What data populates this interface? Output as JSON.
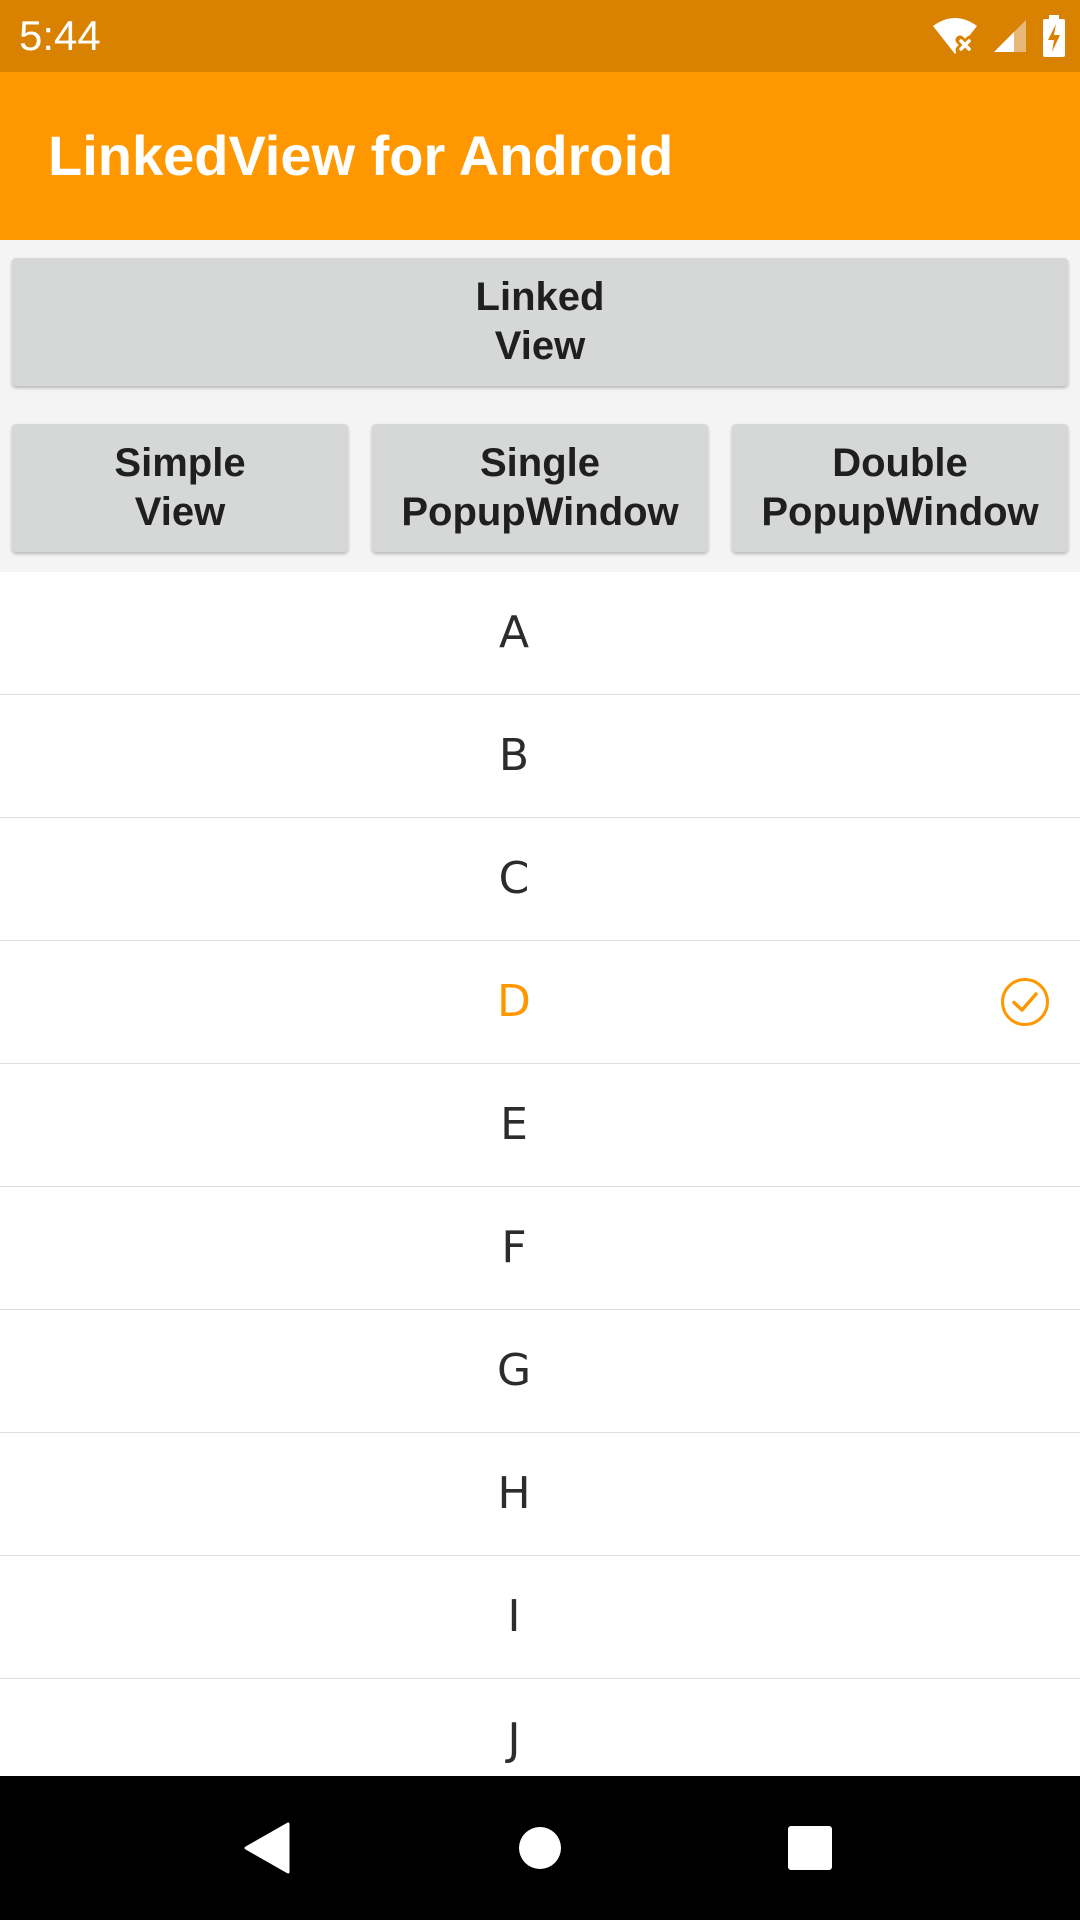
{
  "status_bar": {
    "time": "5:44",
    "icons": [
      "wifi-no-internet-icon",
      "cell-signal-icon",
      "battery-charging-icon"
    ]
  },
  "app_bar": {
    "title": "LinkedView for Android"
  },
  "buttons": {
    "linked_view": "Linked\nView",
    "simple_view": "Simple\nView",
    "single_popup": "Single\nPopupWindow",
    "double_popup": "Double\nPopupWindow"
  },
  "list": {
    "items": [
      {
        "label": "A",
        "selected": false
      },
      {
        "label": "B",
        "selected": false
      },
      {
        "label": "C",
        "selected": false
      },
      {
        "label": "D",
        "selected": true
      },
      {
        "label": "E",
        "selected": false
      },
      {
        "label": "F",
        "selected": false
      },
      {
        "label": "G",
        "selected": false
      },
      {
        "label": "H",
        "selected": false
      },
      {
        "label": "I",
        "selected": false
      },
      {
        "label": "J",
        "selected": false
      }
    ]
  },
  "nav_bar": {
    "icons": [
      "back-icon",
      "home-icon",
      "recents-icon"
    ]
  },
  "colors": {
    "status_bar": "#d98100",
    "app_bar": "#ff9800",
    "accent": "#ff9800",
    "button_bg": "#d6d7d7"
  }
}
